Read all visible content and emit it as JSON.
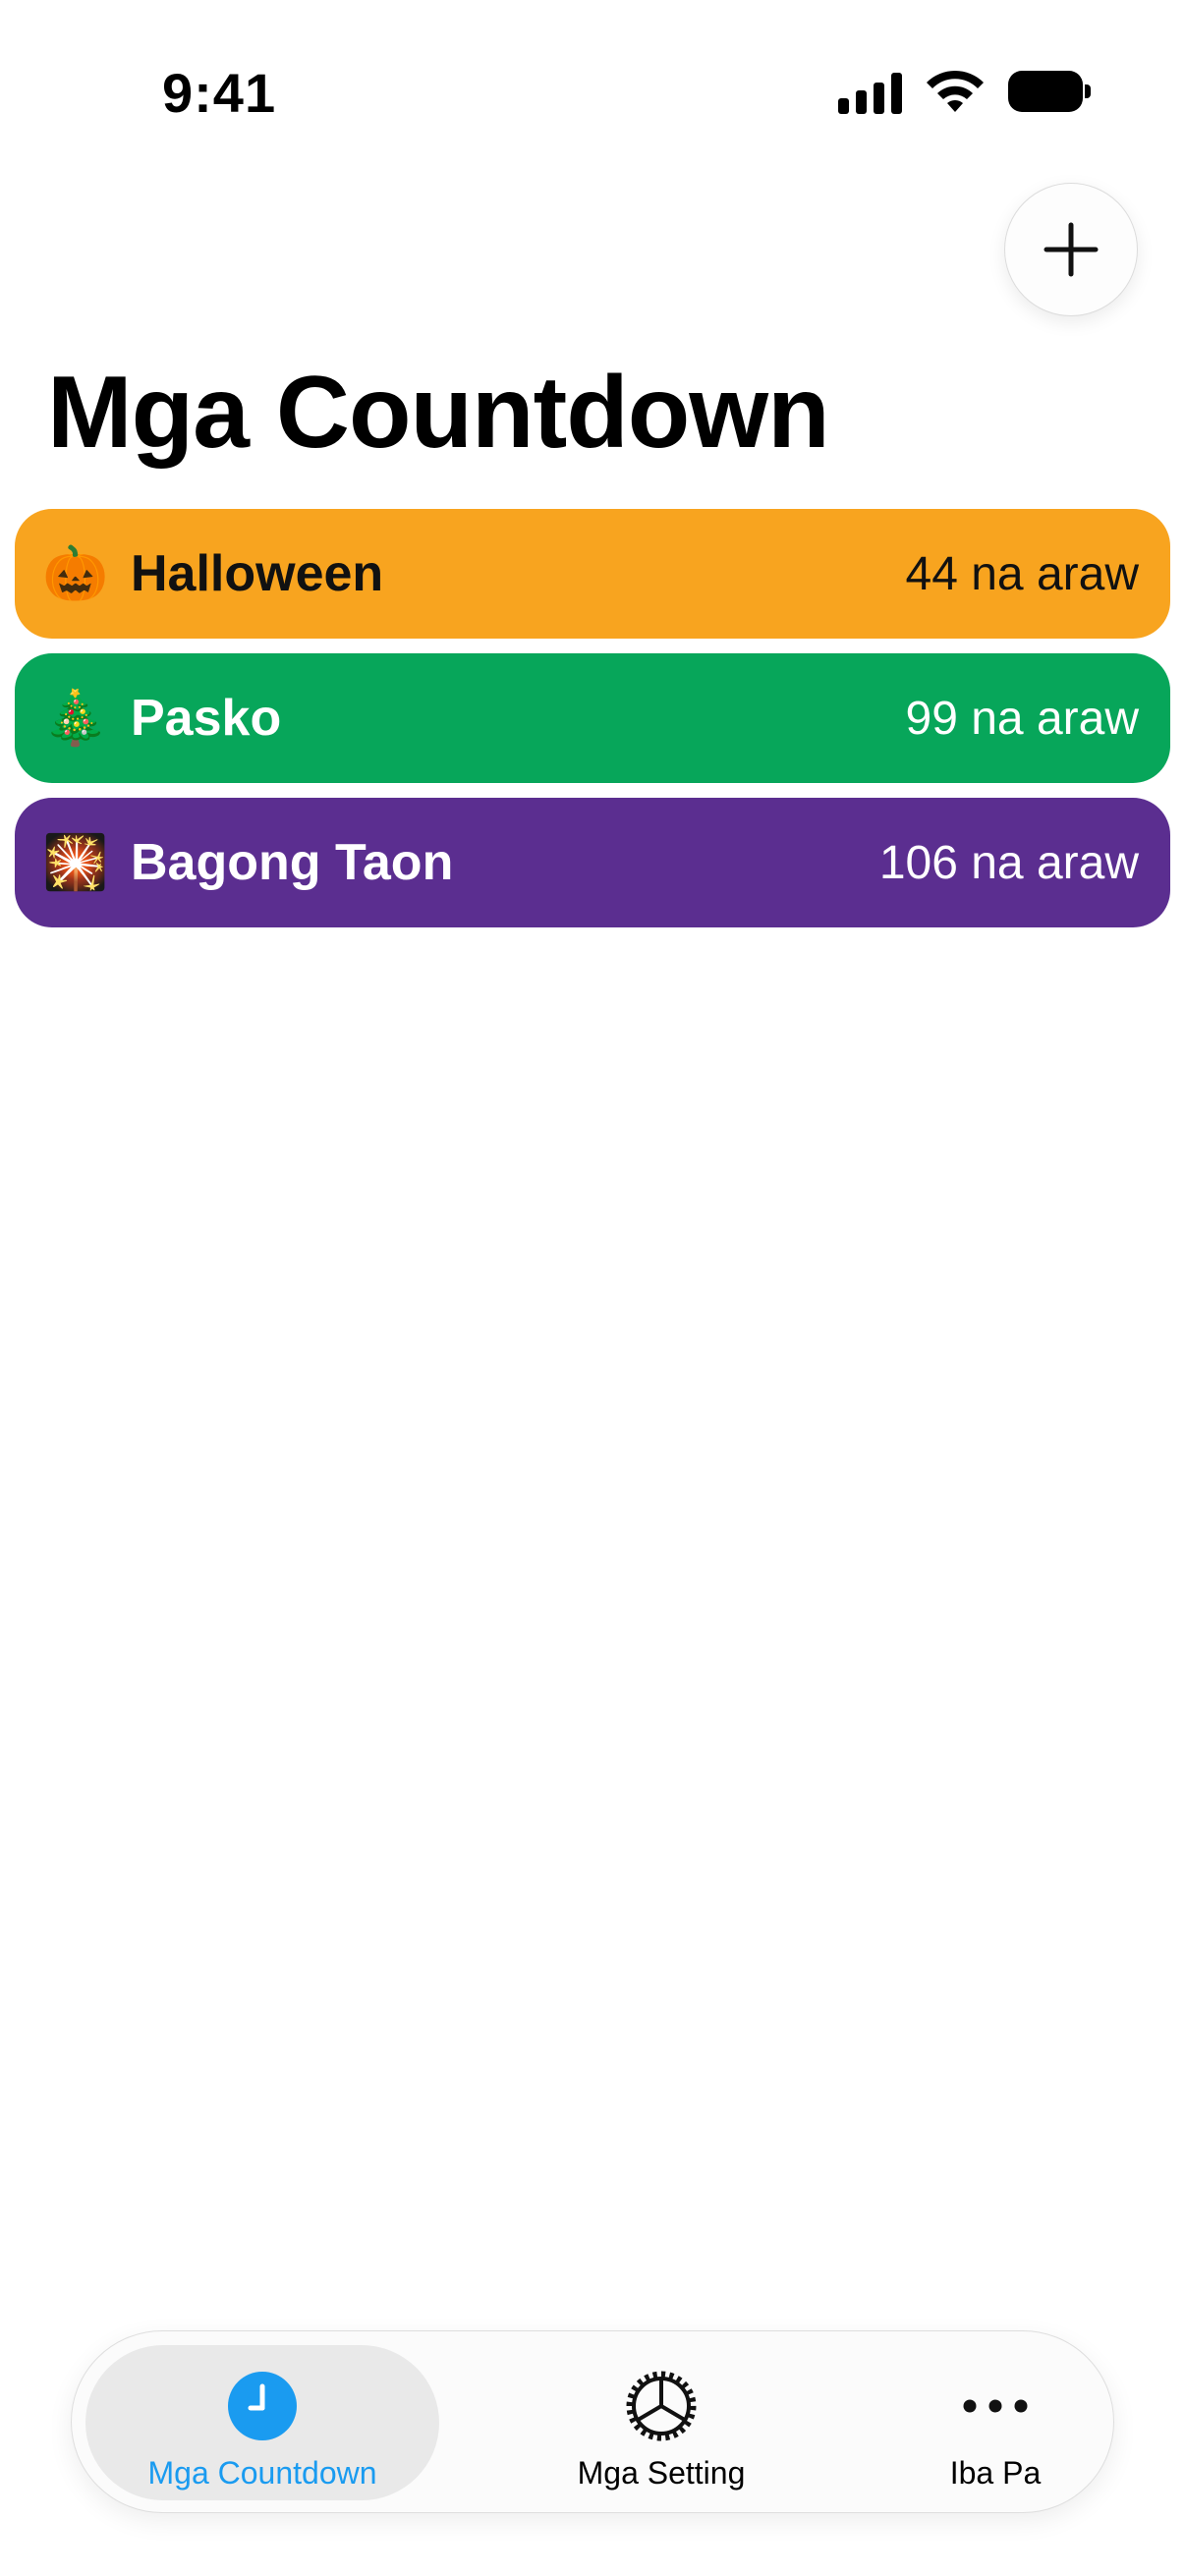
{
  "status_bar": {
    "time": "9:41"
  },
  "header": {
    "title": "Mga Countdown",
    "add_button_icon": "plus-icon"
  },
  "countdowns": [
    {
      "emoji": "🎃",
      "icon": "jack-o-lantern-icon",
      "name": "Halloween",
      "days": "44 na araw",
      "color": "#F8A41F",
      "text_color": "#111111"
    },
    {
      "emoji": "🎄",
      "icon": "christmas-tree-icon",
      "name": "Pasko",
      "days": "99 na araw",
      "color": "#07A65A",
      "text_color": "#FFFFFF"
    },
    {
      "emoji": "🎇",
      "icon": "fireworks-icon",
      "name": "Bagong Taon",
      "days": "106 na araw",
      "color": "#5B2E90",
      "text_color": "#FFFFFF"
    }
  ],
  "tab_bar": {
    "tabs": [
      {
        "label": "Mga Countdown",
        "icon": "clock-icon",
        "active": true
      },
      {
        "label": "Mga Setting",
        "icon": "gear-icon",
        "active": false
      },
      {
        "label": "Iba Pa",
        "icon": "ellipsis-icon",
        "active": false
      }
    ]
  },
  "colors": {
    "accent": "#1A9BF0",
    "active_tab_bg": "#E9E9E9"
  }
}
